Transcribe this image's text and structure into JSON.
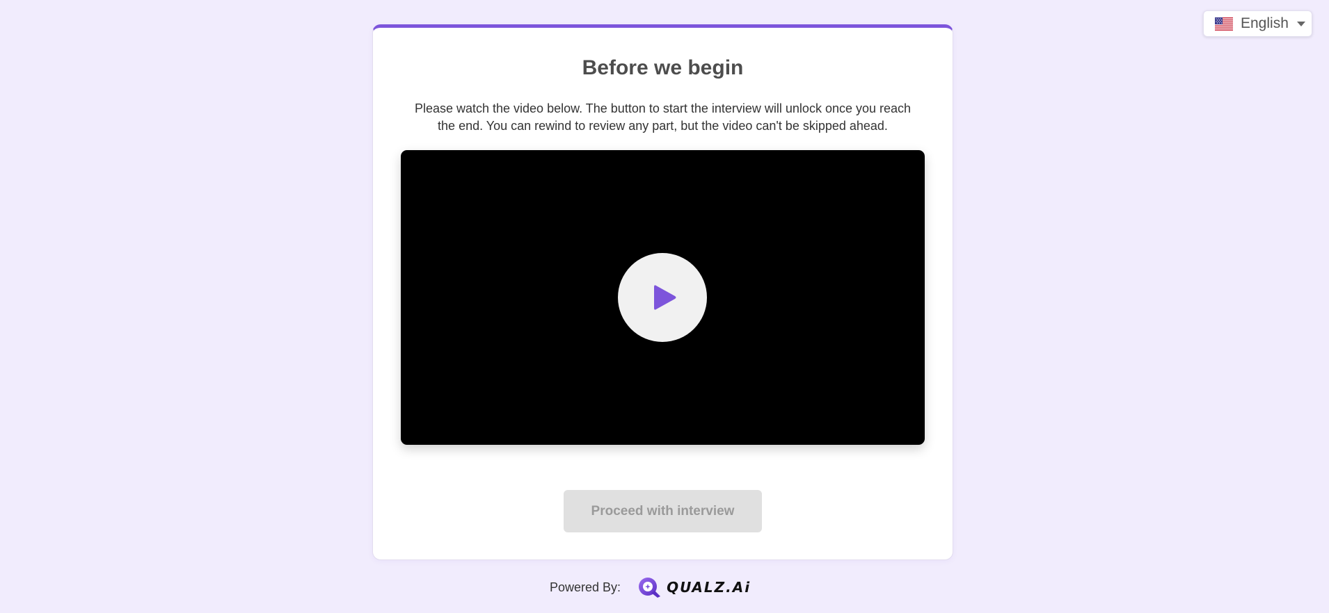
{
  "language_selector": {
    "label": "English",
    "flag_icon": "us-flag-icon",
    "caret_icon": "chevron-down-icon"
  },
  "card": {
    "title": "Before we begin",
    "description": "Please watch the video below. The button to start the interview will unlock once you reach the end. You can rewind to review any part, but the video can't be skipped ahead.",
    "video": {
      "play_icon": "play-icon"
    },
    "proceed_button": {
      "label": "Proceed with interview",
      "state": "disabled"
    }
  },
  "footer": {
    "powered_by_label": "Powered By:",
    "brand_name": "QUALZ.Ai"
  },
  "colors": {
    "accent": "#7d55db",
    "page_background": "#f1ecfd",
    "button_disabled_bg": "#e0e0e0",
    "button_disabled_text": "#9a9a9a"
  }
}
